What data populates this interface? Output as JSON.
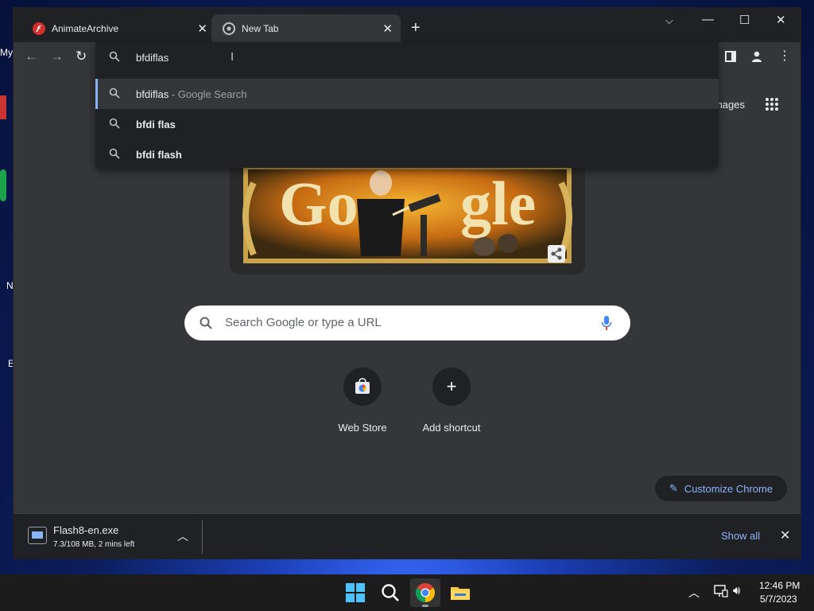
{
  "desktop": {
    "icon_labels": [
      "My",
      "N",
      "E"
    ]
  },
  "tabs": [
    {
      "title": "AnimateArchive",
      "icon": "flash-icon"
    },
    {
      "title": "New Tab",
      "icon": "chrome-icon"
    }
  ],
  "omnibox": {
    "value": "bfdiflas",
    "suggestions": [
      {
        "text": "bfdiflas",
        "suffix": " - Google Search"
      },
      {
        "text": "bfdi flas",
        "suffix": ""
      },
      {
        "text": "bfdi flash",
        "suffix": ""
      }
    ]
  },
  "header": {
    "images_link": "Images"
  },
  "search": {
    "placeholder": "Search Google or type a URL"
  },
  "shortcuts": [
    {
      "label": "Web Store"
    },
    {
      "label": "Add shortcut"
    }
  ],
  "customize": {
    "label": "Customize Chrome"
  },
  "download": {
    "filename": "Flash8-en.exe",
    "status": "7.3/108 MB, 2 mins left",
    "show_all": "Show all"
  },
  "clock": {
    "time": "12:46 PM",
    "date": "5/7/2023"
  },
  "colors": {
    "accent": "#8ab4f8",
    "surface": "#35363a",
    "dark": "#202124"
  }
}
